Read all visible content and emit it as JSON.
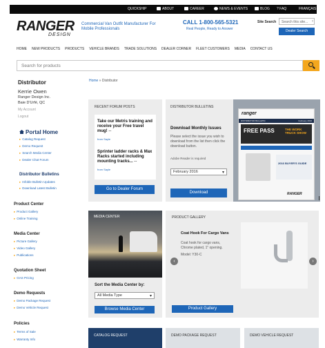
{
  "topbar": {
    "items": [
      "QUICKSHIP",
      "ABOUT",
      "CAREER",
      "NEWS & EVENTS",
      "BLOG",
      "FAQ",
      "FRANÇAIS"
    ]
  },
  "header": {
    "logo_word": "RANGER",
    "logo_sub": "DESIGN",
    "tagline": "Commercial Van Outfit Manufacturer For Mobile Professionals",
    "phone": "CALL 1-800-565-5321",
    "phone_sub": "Real People, Ready to Answer",
    "site_search_label": "Site Search",
    "site_search_placeholder": "Search this site...",
    "site_search_arrow": "›",
    "dealer_search": "Dealer Search"
  },
  "nav": [
    "HOME",
    "NEW PRODUCTS",
    "PRODUCTS",
    "VEHICLE BRANDS",
    "TRADE SOLUTIONS",
    "DEALER CORNER",
    "FLEET CUSTOMERS",
    "MEDIA",
    "CONTACT US"
  ],
  "search": {
    "placeholder": "Search for products"
  },
  "sidebar": {
    "heading": "Distributor",
    "name": "Kerrie Owen",
    "company": "Ranger Design Inc.",
    "location": "Baie D'Urfé, QC",
    "my_account": "My Account",
    "logout": "Logout",
    "portal_home": "Portal Home",
    "portal_links": [
      "Catalog Request",
      "Demo Request",
      "Search Media Center",
      "Dealer Chat Forum"
    ],
    "bulletins_heading": "Distributor Bulletins",
    "bulletins_links": [
      "Infoble Bulletin Updates",
      "Download Latest Bulletin"
    ],
    "product_center": {
      "heading": "Product Center",
      "links": [
        "Product Gallery",
        "Online Training"
      ]
    },
    "media_center": {
      "heading": "Media Center",
      "links": [
        "Picture Gallery",
        "Video Gallery",
        "Publications"
      ]
    },
    "quotation": {
      "heading": "Quotation Sheet",
      "links": [
        "GAS Pricing"
      ]
    },
    "demo_requests": {
      "heading": "Demo Requests",
      "links": [
        "Demo Package Request",
        "Demo Vehicle Request"
      ]
    },
    "policies": {
      "heading": "Policies",
      "links": [
        "Terms of Sale",
        "Warranty Info"
      ]
    }
  },
  "breadcrumb": {
    "home": "Home",
    "sep": "»",
    "current": "Distributor"
  },
  "forum": {
    "heading": "RECENT FORUM POSTS",
    "posts": [
      {
        "title": "Take our Metris training and receive your Free travel mug!",
        "suffix": "--",
        "meta": "from Sayle"
      },
      {
        "title": "Sprinter ladder racks & Max Racks started including mounting tracks...",
        "suffix": "--",
        "meta": "from Sayle"
      }
    ],
    "button": "Go to Dealer Forum"
  },
  "bulletins": {
    "heading": "DISTRIBUTOR BULLETINS",
    "title": "Download Monthly Issues",
    "text": "Please select the issue you wish to download from the list then click the download button.",
    "adobe": "Adobe Reader is required",
    "selected_issue": "February 2016",
    "button": "Download",
    "flyer": {
      "brand": "ranger",
      "header_left": "DISTRIBUTOR BULLETIN",
      "header_right": "February 2016",
      "promo": "FREE PASS",
      "promo2": "THE WORK TRUCK SHOW",
      "guide": "2016 BUYER'S GUIDE",
      "footer_brand": "RANGER"
    }
  },
  "media_center": {
    "heading": "MEDIA CENTER",
    "sort_label": "Sort the Media Center by:",
    "selected": "All Media Type",
    "button": "Browse Media Center"
  },
  "gallery": {
    "heading": "PRODUCT GALLERY",
    "title": "Coat Hook For Cargo Vans",
    "desc": "Coat hook for cargo vans, Chrome plated, 1\" opening.",
    "model": "Model: Y30-C",
    "button": "Product Gallery",
    "prev": "‹",
    "next": "›"
  },
  "bottom_cards": [
    "CATALOG REQUEST",
    "DEMO PACKAGE REQUEST",
    "DEMO VEHICLE REQUEST"
  ]
}
